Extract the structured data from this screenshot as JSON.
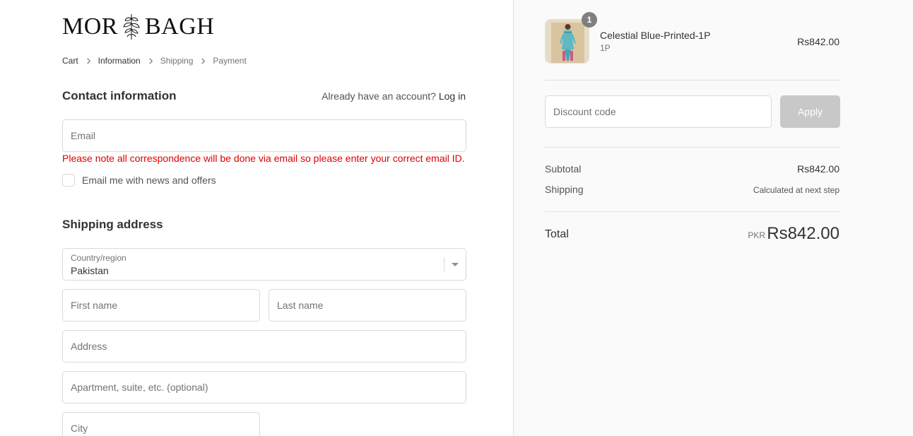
{
  "brand": {
    "logo_left": "MOR",
    "logo_right": "BAGH"
  },
  "breadcrumb": [
    {
      "label": "Cart",
      "state": "link"
    },
    {
      "label": "Information",
      "state": "current"
    },
    {
      "label": "Shipping",
      "state": "upcoming"
    },
    {
      "label": "Payment",
      "state": "upcoming"
    }
  ],
  "contact": {
    "title": "Contact information",
    "account_prompt": "Already have an account?",
    "login_link": "Log in",
    "email_placeholder": "Email",
    "email_value": "",
    "notice": "Please note all correspondence will be done via email so please enter your correct email ID.",
    "newsletter_label": "Email me with news and offers",
    "newsletter_checked": false
  },
  "shipping": {
    "title": "Shipping address",
    "country_label": "Country/region",
    "country_value": "Pakistan",
    "first_name_placeholder": "First name",
    "last_name_placeholder": "Last name",
    "address_placeholder": "Address",
    "apartment_placeholder": "Apartment, suite, etc. (optional)",
    "city_placeholder": "City"
  },
  "summary": {
    "product": {
      "name": "Celestial Blue-Printed-1P",
      "variant": "1P",
      "price": "Rs842.00",
      "quantity": "1",
      "image_icon": "dress-product-image"
    },
    "discount_placeholder": "Discount code",
    "apply_label": "Apply",
    "subtotal_label": "Subtotal",
    "subtotal_value": "Rs842.00",
    "shipping_label": "Shipping",
    "shipping_value": "Calculated at next step",
    "total_label": "Total",
    "total_currency": "PKR",
    "total_value": "Rs842.00"
  },
  "colors": {
    "notice_red": "#e00000",
    "sidebar_bg": "#fafafa",
    "apply_disabled": "#c8c8c8",
    "badge": "#727272"
  }
}
